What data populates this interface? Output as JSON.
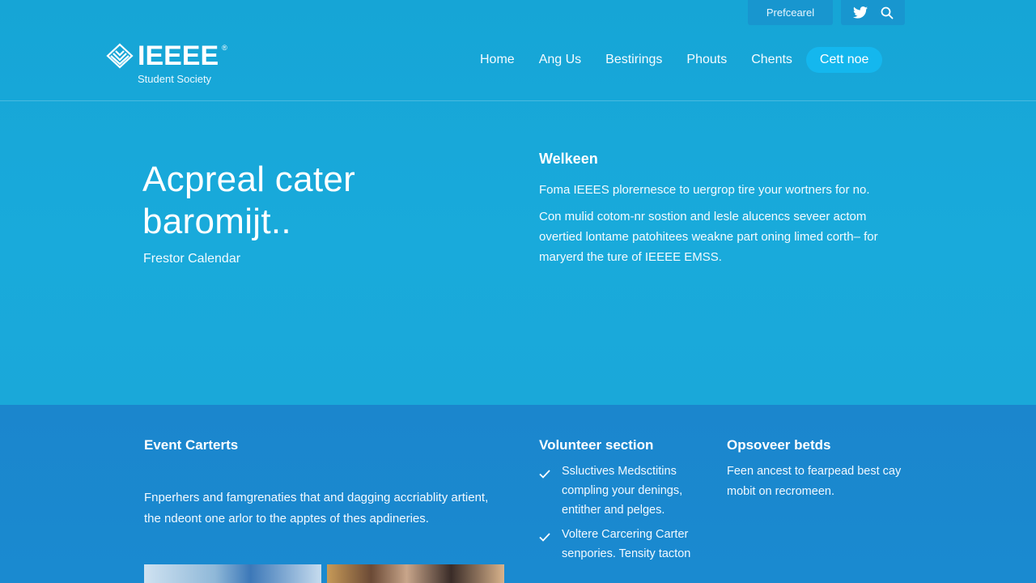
{
  "utility": {
    "preferences_label": "Prefcearel",
    "twitter_icon": "twitter-icon",
    "search_icon": "search-icon"
  },
  "brand": {
    "name": "IEEEE",
    "registered_mark": "®",
    "subtitle": "Student Society",
    "logo_icon": "ieee-diamond-logo-icon"
  },
  "nav": {
    "items": [
      {
        "label": "Home"
      },
      {
        "label": "Ang Us"
      },
      {
        "label": "Bestirings"
      },
      {
        "label": "Phouts"
      },
      {
        "label": "Chents"
      }
    ],
    "cta_label": "Cett noe"
  },
  "hero": {
    "title": "Acpreal cater baromijt..",
    "subtitle": "Frestor Calendar"
  },
  "welcome": {
    "heading": "Welkeen",
    "paragraphs": [
      "Foma IEEES plorernesce to uergrop tire your wortners for no.",
      "Con mulid cotom-nr sostion and lesle alucencs seveer actom overtied lontame patohitees weakne part oning limed corth– for maryerd the ture of IEEEE EMSS."
    ]
  },
  "events": {
    "heading": "Event Carterts",
    "body": "Fnperhers and famgrenaties that and dagging accriablity artient, the ndeont one arlor to the apptes of thes apdineries."
  },
  "volunteer": {
    "heading": "Volunteer section",
    "items": [
      {
        "text": "Ssluctives Medsctitins compling your denings, entither and pelges."
      },
      {
        "text": "Voltere Carcering Carter senpories. Tensity tacton"
      }
    ],
    "check_icon": "checkmark-icon"
  },
  "observer": {
    "heading": "Opsoveer betds",
    "body": "Feen ancest to fearpead best cay mobit on recromeen."
  },
  "colors": {
    "hero_bg": "#19aadb",
    "lower_bg": "#1b86cd",
    "cta_bg": "#14b7ee",
    "utility_bg": "#1896cf",
    "text": "#ffffff"
  }
}
